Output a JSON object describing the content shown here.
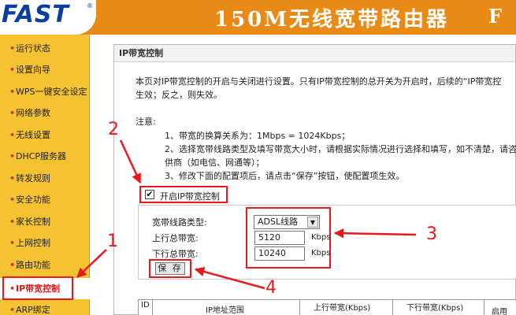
{
  "header": {
    "logo": "FAST",
    "logo_mark": "®",
    "title": "150M无线宽带路由器",
    "title_tail": "F"
  },
  "sidebar": {
    "items": [
      {
        "label": "运行状态"
      },
      {
        "label": "设置向导"
      },
      {
        "label": "WPS一键安全设定"
      },
      {
        "label": "网络参数"
      },
      {
        "label": "无线设置"
      },
      {
        "label": "DHCP服务器"
      },
      {
        "label": "转发规则"
      },
      {
        "label": "安全功能"
      },
      {
        "label": "家长控制"
      },
      {
        "label": "上网控制"
      },
      {
        "label": "路由功能"
      },
      {
        "label": "IP带宽控制"
      },
      {
        "label": "ARP绑定"
      }
    ],
    "active_index": 11
  },
  "panel": {
    "title": "IP带宽控制",
    "intro_line1": "本页对IP带宽控制的开启与关闭进行设置。只有IP带宽控制的总开关为开启时，后续的“IP带宽控",
    "intro_line2": "生效；反之，则失效。",
    "notes_label": "注意:",
    "notes": [
      "1、带宽的换算关系为：1Mbps = 1024Kbps；",
      "2、选择宽带线路类型及填写带宽大小时，请根据实际情况进行选择和填写，如不清楚，请咨",
      "供商（如电信、网通等）；",
      "3、修改下面的配置项后，请点击“保存”按钮，使配置项生效。"
    ],
    "enable_label": "开启IP带宽控制",
    "enable_checked": "✔",
    "form": {
      "line_type_label": "宽带线路类型:",
      "line_type_value": "ADSL线路",
      "up_label": "上行总带宽:",
      "up_value": "5120",
      "down_label": "下行总带宽:",
      "down_value": "10240",
      "unit": "Kbps",
      "save_label": "保 存"
    },
    "table_headers": {
      "id": "ID",
      "ip_range": "IP地址范围",
      "up": "上行带宽(Kbps)",
      "down": "下行带宽(Kbps)",
      "enable": "启用"
    }
  },
  "annotations": {
    "n1": "1",
    "n2": "2",
    "n3": "3",
    "n4": "4",
    "color": "#e8181d"
  }
}
